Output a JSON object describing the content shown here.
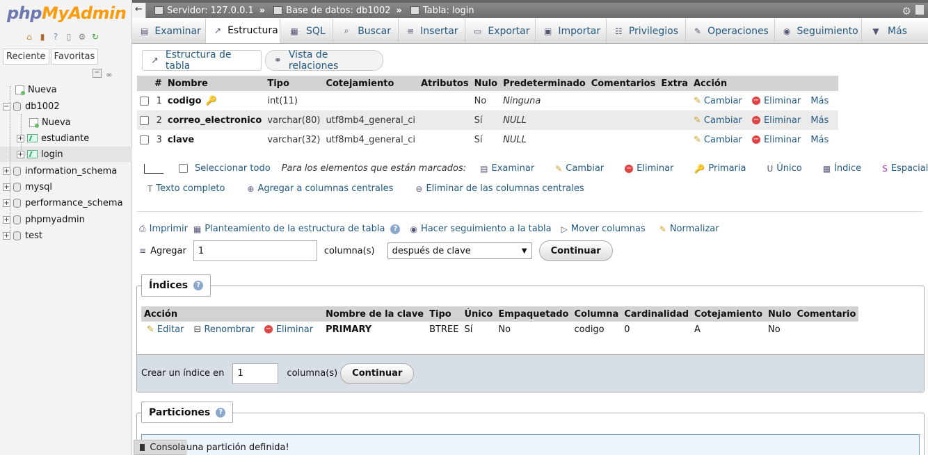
{
  "logo": {
    "php": "php",
    "admin": "MyAdmin"
  },
  "nav": {
    "tabs": [
      "Reciente",
      "Favoritas"
    ],
    "tree": {
      "new_root": "Nueva",
      "db1002": "db1002",
      "db_new": "Nueva",
      "estudiante": "estudiante",
      "login": "login",
      "information_schema": "information_schema",
      "mysql": "mysql",
      "performance_schema": "performance_schema",
      "phpmyadmin": "phpmyadmin",
      "test": "test"
    }
  },
  "breadcrumb": {
    "server": "Servidor: 127.0.0.1",
    "database": "Base de datos: db1002",
    "table": "Tabla: login",
    "sep": "»"
  },
  "menu": [
    {
      "label": "Examinar",
      "icon": "browse-icon"
    },
    {
      "label": "Estructura",
      "icon": "structure-icon"
    },
    {
      "label": "SQL",
      "icon": "sql-icon"
    },
    {
      "label": "Buscar",
      "icon": "search-icon"
    },
    {
      "label": "Insertar",
      "icon": "insert-icon"
    },
    {
      "label": "Exportar",
      "icon": "export-icon"
    },
    {
      "label": "Importar",
      "icon": "import-icon"
    },
    {
      "label": "Privilegios",
      "icon": "privileges-icon"
    },
    {
      "label": "Operaciones",
      "icon": "wrench-icon"
    },
    {
      "label": "Seguimiento",
      "icon": "eye-icon"
    },
    {
      "label": "Más",
      "icon": "caret-down-icon"
    }
  ],
  "subtabs": {
    "structure": "Estructura de tabla",
    "relations": "Vista de relaciones"
  },
  "structure": {
    "headers": [
      "#",
      "Nombre",
      "Tipo",
      "Cotejamiento",
      "Atributos",
      "Nulo",
      "Predeterminado",
      "Comentarios",
      "Extra",
      "Acción"
    ],
    "rows": [
      {
        "num": "1",
        "name": "codigo",
        "type": "int(11)",
        "collation": "",
        "null": "No",
        "default": "Ninguna"
      },
      {
        "num": "2",
        "name": "correo_electronico",
        "type": "varchar(80)",
        "collation": "utf8mb4_general_ci",
        "null": "Sí",
        "default": "NULL"
      },
      {
        "num": "3",
        "name": "clave",
        "type": "varchar(32)",
        "collation": "utf8mb4_general_ci",
        "null": "Sí",
        "default": "NULL"
      }
    ],
    "actions": {
      "change": "Cambiar",
      "drop": "Eliminar",
      "more": "Más"
    }
  },
  "bulk": {
    "select_all": "Seleccionar todo",
    "with_selected": "Para los elementos que están marcados:",
    "browse": "Examinar",
    "change": "Cambiar",
    "drop": "Eliminar",
    "primary": "Primaria",
    "unique": "Único",
    "index": "Índice",
    "spatial": "Espacial",
    "fulltext": "Texto completo",
    "add_central": "Agregar a columnas centrales",
    "remove_central": "Eliminar de las columnas centrales"
  },
  "tools": {
    "print": "Imprimir",
    "propose": "Planteamiento de la estructura de tabla",
    "track": "Hacer seguimiento a la tabla",
    "move": "Mover columnas",
    "normalize": "Normalizar"
  },
  "add_columns": {
    "label": "Agregar",
    "count": "1",
    "unit": "columna(s)",
    "position": "después de clave",
    "go": "Continuar"
  },
  "indexes": {
    "legend": "Índices",
    "headers": [
      "Acción",
      "Nombre de la clave",
      "Tipo",
      "Único",
      "Empaquetado",
      "Columna",
      "Cardinalidad",
      "Cotejamiento",
      "Nulo",
      "Comentario"
    ],
    "row": {
      "edit": "Editar",
      "rename": "Renombrar",
      "drop": "Eliminar",
      "key": "PRIMARY",
      "type": "BTREE",
      "unique": "Sí",
      "packed": "No",
      "column": "codigo",
      "cardinality": "0",
      "collation": "A",
      "null": "No",
      "comment": ""
    },
    "create_label": "Crear un índice en",
    "create_count": "1",
    "create_unit": "columna(s)",
    "go": "Continuar"
  },
  "partitions": {
    "legend": "Particiones",
    "message": "una partición definida!"
  },
  "console": {
    "label": "Consola"
  }
}
